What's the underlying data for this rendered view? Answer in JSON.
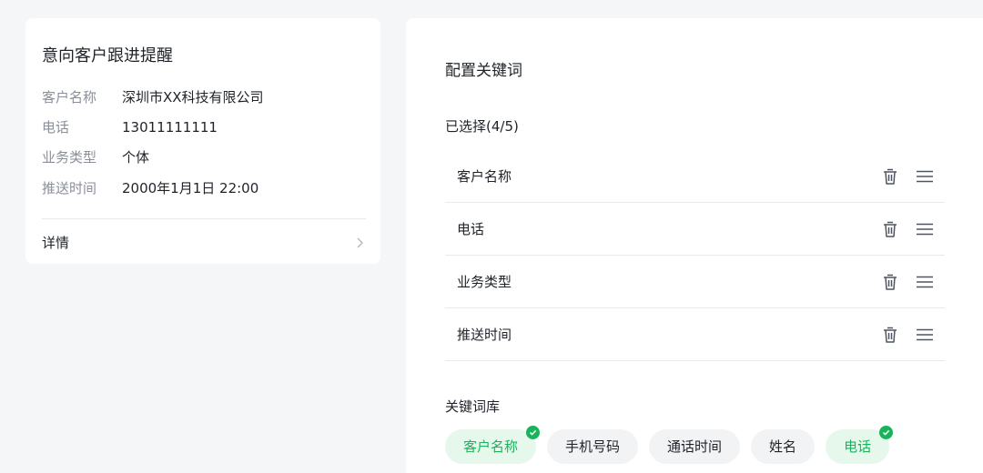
{
  "reminder_card": {
    "title": "意向客户跟进提醒",
    "fields": [
      {
        "key": "客户名称",
        "value": "深圳市XX科技有限公司"
      },
      {
        "key": "电话",
        "value": "13011111111"
      },
      {
        "key": "业务类型",
        "value": "个体"
      },
      {
        "key": "推送时间",
        "value": "2000年1月1日 22:00"
      }
    ],
    "detail_label": "详情",
    "detail_icon": "chevron-right-icon"
  },
  "config_panel": {
    "title": "配置关键词",
    "selected_label": "已选择(4/5)",
    "selected_keywords": [
      {
        "label": "客户名称"
      },
      {
        "label": "电话"
      },
      {
        "label": "业务类型"
      },
      {
        "label": "推送时间"
      }
    ],
    "row_icons": [
      "delete-icon",
      "drag-handle-icon"
    ],
    "library_label": "关键词库",
    "library_keywords": [
      {
        "label": "客户名称",
        "selected": true
      },
      {
        "label": "手机号码",
        "selected": false
      },
      {
        "label": "通话时间",
        "selected": false
      },
      {
        "label": "姓名",
        "selected": false
      },
      {
        "label": "电话",
        "selected": true
      }
    ]
  },
  "colors": {
    "page_background": "#f5f6f8",
    "card_background": "#ffffff",
    "accent_green": "#19b35c",
    "selected_chip_background": "#e6f7ec",
    "chip_background": "#f2f3f5",
    "muted_text": "#8a8f99",
    "divider": "#e8e9ec"
  }
}
